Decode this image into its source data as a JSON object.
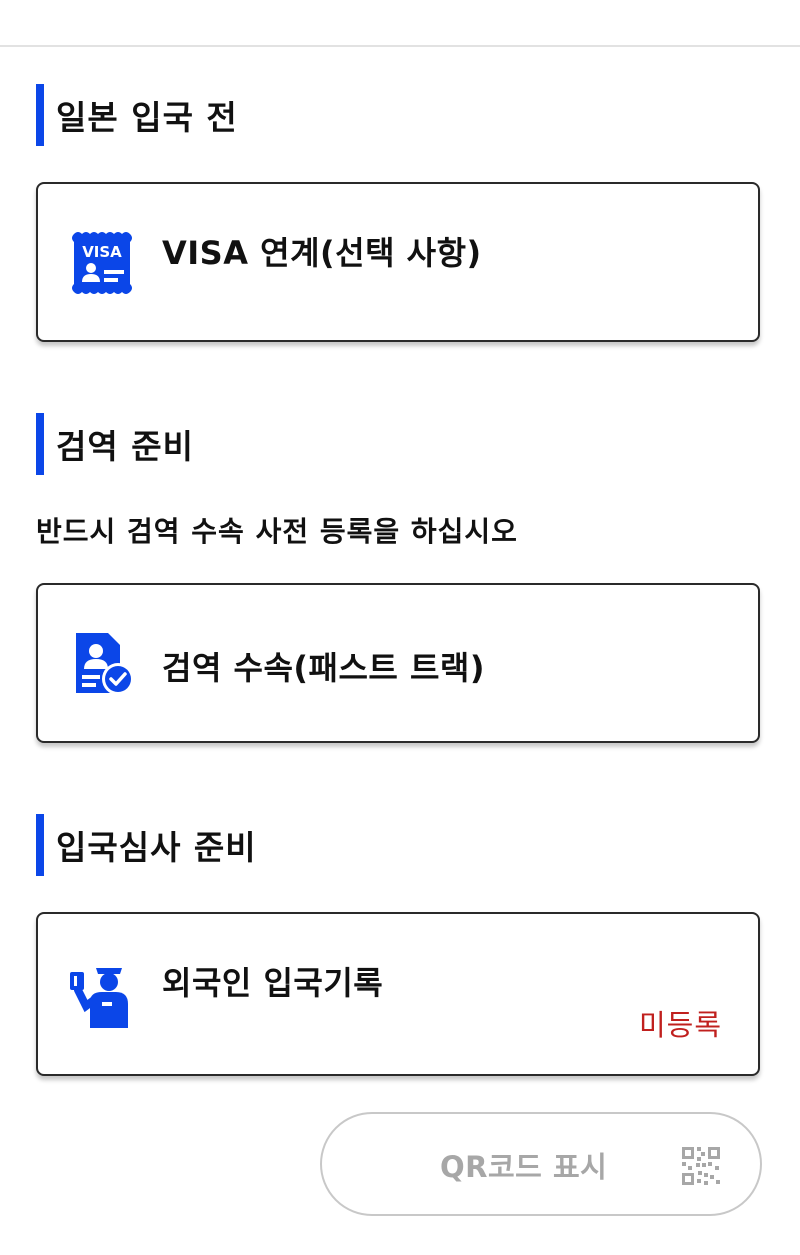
{
  "sections": [
    {
      "title": "일본 입국 전",
      "cards": [
        {
          "label": "VISA 연계(선택 사항)",
          "icon": "visa-card-icon"
        }
      ]
    },
    {
      "title": "검역 준비",
      "description": "반드시 검역 수속 사전 등록을 하십시오",
      "cards": [
        {
          "label": "검역 수속(패스트 트랙)",
          "icon": "quarantine-document-check-icon"
        }
      ]
    },
    {
      "title": "입국심사 준비",
      "cards": [
        {
          "label": "외국인 입국기록",
          "icon": "immigration-officer-icon",
          "status": "미등록"
        }
      ]
    }
  ],
  "visa_icon_text": "VISA",
  "qr_button": {
    "label": "QR코드 표시",
    "icon": "qr-code-icon"
  },
  "colors": {
    "accent": "#0b46e8",
    "status_unregistered": "#c0201e",
    "disabled_text": "#a7a7a7"
  }
}
